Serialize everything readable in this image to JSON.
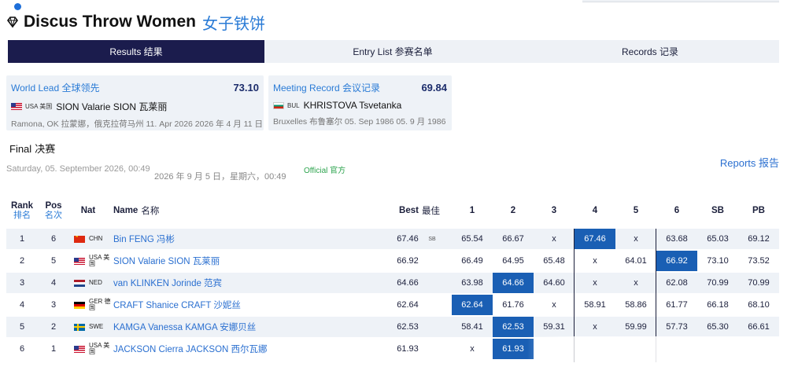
{
  "event": {
    "title_en": "Discus Throw Women",
    "title_cn": "女子铁饼"
  },
  "tabs": [
    {
      "label": "Results  结果",
      "active": true
    },
    {
      "label": "Entry List  参赛名单",
      "active": false
    },
    {
      "label": "Records  记录",
      "active": false
    }
  ],
  "world_lead": {
    "label": "World Lead  全球领先",
    "value": "73.10",
    "nat": "USA  美国",
    "athlete": "SION Valarie  SION 瓦莱丽",
    "place": "Ramona, OK  拉蒙娜，俄克拉荷马州 11. Apr 2026  2026 年 4 月 11 日"
  },
  "meeting_record": {
    "label": "Meeting Record  会议记录",
    "value": "69.84",
    "nat": "BUL",
    "athlete": "KHRISTOVA Tsvetanka",
    "place": "Bruxelles  布鲁塞尔 05. Sep 1986  05. 9 月 1986"
  },
  "round": {
    "label_en": "Final",
    "label_cn": "决赛"
  },
  "date_en": "Saturday, 05. September 2026, 00:49",
  "date_cn": "2026 年 9 月 5 日，星期六，00:49",
  "status": "Official  官方",
  "reports": "Reports  报告",
  "headers": {
    "rank": "Rank",
    "rank_cn": "排名",
    "pos": "Pos",
    "pos_cn": "名次",
    "nat": "Nat",
    "name": "Name",
    "name_cn": "名称",
    "best": "Best",
    "best_cn": "最佳",
    "a1": "1",
    "a2": "2",
    "a3": "3",
    "a4": "4",
    "a5": "5",
    "a6": "6",
    "sb": "SB",
    "pb": "PB"
  },
  "colors": {
    "accent": "#1a5fb4",
    "tab_active": "#1b1c4d",
    "link": "#2a6fd0",
    "official": "#2ea44f"
  },
  "rows": [
    {
      "rank": "1",
      "pos": "6",
      "flag": "chn",
      "nat": "CHN",
      "name": "Bin FENG  冯彬",
      "best": "67.46",
      "tag": "SB",
      "a1": "65.54",
      "a2": "66.67",
      "a3": "x",
      "a4": "67.46",
      "a5": "x",
      "a6": "63.68",
      "sb": "65.03",
      "pb": "69.12",
      "hl": "a4"
    },
    {
      "rank": "2",
      "pos": "5",
      "flag": "usa",
      "nat": "USA 美国",
      "name": "SION Valarie  SION 瓦莱丽",
      "best": "66.92",
      "tag": "",
      "a1": "66.49",
      "a2": "64.95",
      "a3": "65.48",
      "a4": "x",
      "a5": "64.01",
      "a6": "66.92",
      "sb": "73.10",
      "pb": "73.52",
      "hl": "a6"
    },
    {
      "rank": "3",
      "pos": "4",
      "flag": "ned",
      "nat": "NED",
      "name": "van KLINKEN Jorinde  范宾",
      "best": "64.66",
      "tag": "",
      "a1": "63.98",
      "a2": "64.66",
      "a3": "64.60",
      "a4": "x",
      "a5": "x",
      "a6": "62.08",
      "sb": "70.99",
      "pb": "70.99",
      "hl": "a2"
    },
    {
      "rank": "4",
      "pos": "3",
      "flag": "ger",
      "nat": "GER 德国",
      "name": "CRAFT Shanice  CRAFT 沙妮丝",
      "best": "62.64",
      "tag": "",
      "a1": "62.64",
      "a2": "61.76",
      "a3": "x",
      "a4": "58.91",
      "a5": "58.86",
      "a6": "61.77",
      "sb": "66.18",
      "pb": "68.10",
      "hl": "a1"
    },
    {
      "rank": "5",
      "pos": "2",
      "flag": "swe",
      "nat": "SWE",
      "name": "KAMGA Vanessa  KAMGA 安娜贝丝",
      "best": "62.53",
      "tag": "",
      "a1": "58.41",
      "a2": "62.53",
      "a3": "59.31",
      "a4": "x",
      "a5": "59.99",
      "a6": "57.73",
      "sb": "65.30",
      "pb": "66.61",
      "hl": "a2"
    },
    {
      "rank": "6",
      "pos": "1",
      "flag": "usa",
      "nat": "USA 美国",
      "name": "JACKSON Cierra  JACKSON 西尔瓦娜",
      "best": "61.93",
      "tag": "",
      "a1": "x",
      "a2": "61.93",
      "a3": "",
      "a4": "",
      "a5": "",
      "a6": "",
      "sb": "",
      "pb": "",
      "hl": "a2"
    }
  ]
}
